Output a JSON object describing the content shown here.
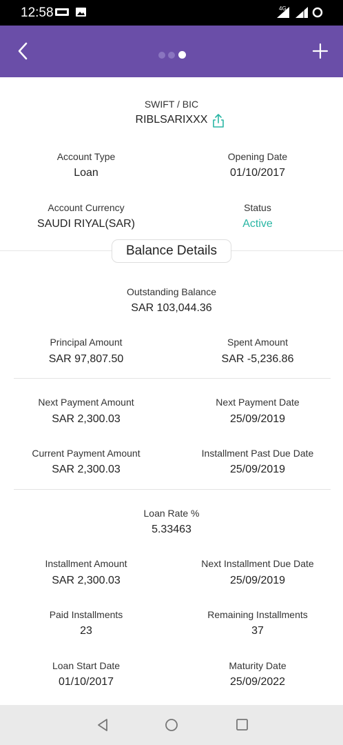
{
  "status_bar": {
    "time": "12:58",
    "network": "4G"
  },
  "app_bar": {
    "page_indicator": {
      "count": 3,
      "active_index": 2
    }
  },
  "account": {
    "swift_label": "SWIFT / BIC",
    "swift_value": "RIBLSARIXXX",
    "account_type_label": "Account Type",
    "account_type_value": "Loan",
    "opening_date_label": "Opening Date",
    "opening_date_value": "01/10/2017",
    "currency_label": "Account Currency",
    "currency_value": "SAUDI RIYAL(SAR)",
    "status_label": "Status",
    "status_value": "Active"
  },
  "balance": {
    "title": "Balance Details",
    "outstanding_label": "Outstanding Balance",
    "outstanding_value": "SAR 103,044.36",
    "principal_label": "Principal Amount",
    "principal_value": "SAR 97,807.50",
    "spent_label": "Spent Amount",
    "spent_value": "SAR -5,236.86",
    "next_payment_amount_label": "Next Payment Amount",
    "next_payment_amount_value": "SAR 2,300.03",
    "next_payment_date_label": "Next Payment Date",
    "next_payment_date_value": "25/09/2019",
    "current_payment_label": "Current Payment Amount",
    "current_payment_value": "SAR 2,300.03",
    "past_due_label": "Installment Past Due Date",
    "past_due_value": "25/09/2019",
    "loan_rate_label": "Loan Rate %",
    "loan_rate_value": "5.33463",
    "installment_amount_label": "Installment Amount",
    "installment_amount_value": "SAR 2,300.03",
    "next_installment_label": "Next Installment Due Date",
    "next_installment_value": "25/09/2019",
    "paid_label": "Paid Installments",
    "paid_value": "23",
    "remaining_label": "Remaining Installments",
    "remaining_value": "37",
    "start_label": "Loan Start Date",
    "start_value": "01/10/2017",
    "maturity_label": "Maturity Date",
    "maturity_value": "25/09/2022"
  },
  "colors": {
    "app_bar": "#6a4ea8",
    "status_active": "#29b6a4"
  }
}
